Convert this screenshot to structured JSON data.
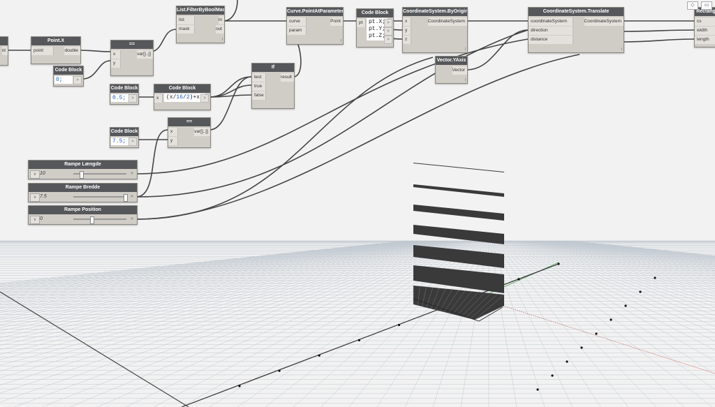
{
  "toolbar": {
    "icons": [
      "3d-view-icon",
      "graph-view-icon"
    ]
  },
  "nodes": {
    "list_filter": {
      "title": "List.FilterByBoolMask",
      "in": [
        "list",
        "mask"
      ],
      "out": [
        "in",
        "out"
      ],
      "lacing": "l"
    },
    "point_x": {
      "title": "Point.X",
      "in": [
        "point"
      ],
      "out": [
        "double"
      ]
    },
    "eq1": {
      "title": "==",
      "in": [
        "x",
        "y"
      ],
      "out": [
        "var[]..[]"
      ]
    },
    "code1": {
      "title": "Code Block",
      "value": "0;"
    },
    "code2": {
      "title": "Code Block",
      "value": "0.5;"
    },
    "code3": {
      "title": "Code Block",
      "expr_prefix": "(x/",
      "expr_num": "16",
      "expr_mid": "/",
      "expr_num2": "2",
      "expr_suffix": ")+x;",
      "in": [
        "x"
      ]
    },
    "code4": {
      "title": "Code Block",
      "value": "7.5;"
    },
    "eq2": {
      "title": "==",
      "in": [
        "x",
        "y"
      ],
      "out": [
        "var[]..[]"
      ]
    },
    "if_node": {
      "title": "If",
      "in": [
        "test",
        "true",
        "false"
      ],
      "out": [
        "result"
      ]
    },
    "curve_pt": {
      "title": "Curve.PointAtParameter",
      "in": [
        "curve",
        "param"
      ],
      "out": [
        "Point"
      ],
      "lacing": "l"
    },
    "code5": {
      "title": "Code Block",
      "in": [
        "pt"
      ],
      "lines": [
        "pt.X;",
        "pt.Y;",
        "pt.Z;"
      ]
    },
    "cs_origin": {
      "title": "CoordinateSystem.ByOrigin",
      "in": [
        "x",
        "y",
        "z"
      ],
      "out": [
        "CoordinateSystem"
      ],
      "lacing": "l"
    },
    "vec_y": {
      "title": "Vector.YAxis",
      "out": [
        "Vector"
      ],
      "lacing": "l"
    },
    "cs_translate": {
      "title": "CoordinateSystem.Translate",
      "in": [
        "coordinateSystem",
        "direction",
        "distance"
      ],
      "out": [
        "CoordinateSystem"
      ],
      "lacing": "l"
    },
    "rectangle": {
      "title": "Rectangl",
      "in": [
        "cs",
        "width",
        "length"
      ]
    },
    "left_partial": {
      "out": [
        "nt"
      ]
    }
  },
  "sliders": [
    {
      "title": "Rampe Længde",
      "value": "10",
      "fraction": 0.13
    },
    {
      "title": "Rampe Bredde",
      "value": "7.5",
      "fraction": 1.0
    },
    {
      "title": "Rampe Position",
      "value": "0",
      "fraction": 0.33
    }
  ],
  "arrow_glyph": ">",
  "chevron_glyph": "v"
}
